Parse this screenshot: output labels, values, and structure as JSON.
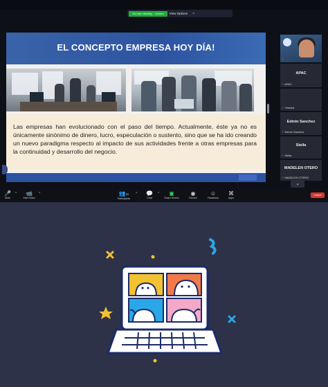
{
  "share_banner": {
    "sharing_text": "You are viewing ... screen",
    "options_label": "View Options",
    "close_glyph": "×"
  },
  "slide": {
    "title": "EL CONCEPTO EMPRESA HOY DÍA!",
    "body": "Las empresas han evolucionado con el paso del tiempo. Actualmente, éste ya no es únicamente sinónimo de dinero, lucro, especulación o sustento, sino que se ha ido creando un nuevo paradigma respecto al impacto de sus actividades frente a otras empresas para la continuidad y desarrollo del negocio."
  },
  "participants": [
    {
      "name": "",
      "tag": "",
      "type": "video"
    },
    {
      "name": "APAC",
      "tag": "APAC"
    },
    {
      "name": "",
      "tag": "Yessica"
    },
    {
      "name": "Edmin Sanchez",
      "tag": "Edmin Sanchez"
    },
    {
      "name": "Stella",
      "tag": "Stella"
    },
    {
      "name": "MADELEN OTERO",
      "tag": "MADELEN OTERO"
    }
  ],
  "panel": {
    "chevron": "⌄"
  },
  "toolbar": {
    "mute_label": "Mute",
    "video_label": "Start Video",
    "participants_label": "Participants",
    "participants_count": "20",
    "chat_label": "Chat",
    "share_label": "Share Screen",
    "record_label": "Record",
    "reactions_label": "Reactions",
    "apps_label": "Apps",
    "leave_label": "Leave"
  },
  "colors": {
    "slide_title_bg": "#2d53a0",
    "share_green": "#1fae3b",
    "leave_red": "#d9362f",
    "placeholder_bg": "#2d3248",
    "illus_blue": "#2aa7e6",
    "illus_yellow": "#f2c230"
  },
  "icons": {
    "mute": "microphone-icon",
    "video": "video-camera-icon",
    "participants": "people-icon",
    "chat": "chat-bubble-icon",
    "share": "share-screen-icon",
    "record": "record-icon",
    "reactions": "smiley-icon",
    "apps": "apps-icon",
    "illustration": "laptop-video-call-icon"
  }
}
